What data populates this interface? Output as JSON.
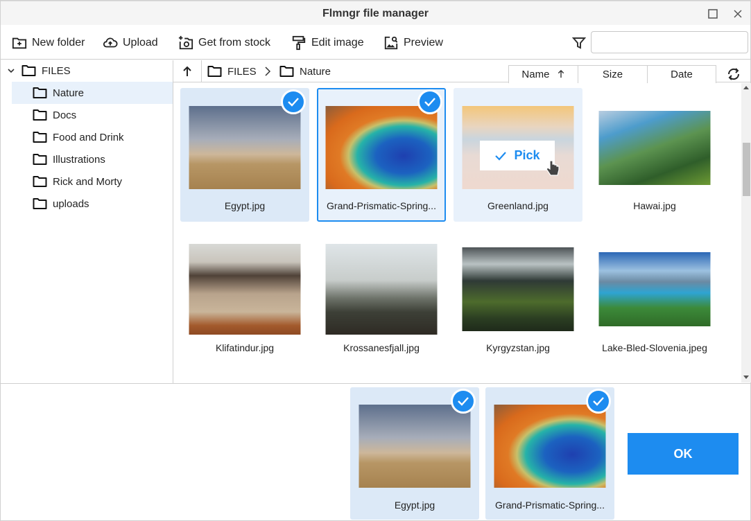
{
  "window": {
    "title": "Flmngr file manager",
    "maximize_icon": "square-icon",
    "close_icon": "close-icon"
  },
  "toolbar": {
    "buttons": [
      {
        "label": "New folder",
        "icon": "folder-plus-icon"
      },
      {
        "label": "Upload",
        "icon": "cloud-upload-icon"
      },
      {
        "label": "Get from stock",
        "icon": "camera-plus-icon"
      },
      {
        "label": "Edit image",
        "icon": "paint-roller-icon"
      },
      {
        "label": "Preview",
        "icon": "image-search-icon"
      }
    ],
    "filter_icon": "filter-icon",
    "search": {
      "value": "",
      "placeholder": ""
    }
  },
  "sidebar": {
    "root": {
      "label": "FILES",
      "expanded": true
    },
    "items": [
      {
        "label": "Nature",
        "active": true
      },
      {
        "label": "Docs",
        "active": false
      },
      {
        "label": "Food and Drink",
        "active": false
      },
      {
        "label": "Illustrations",
        "active": false
      },
      {
        "label": "Rick and Morty",
        "active": false
      },
      {
        "label": "uploads",
        "active": false
      }
    ]
  },
  "breadcrumb": {
    "items": [
      "FILES",
      "Nature"
    ]
  },
  "sort": {
    "tabs": [
      {
        "label": "Name",
        "active": true,
        "direction": "ascending"
      },
      {
        "label": "Size",
        "active": false
      },
      {
        "label": "Date",
        "active": false
      }
    ],
    "refresh_icon": "refresh-icon"
  },
  "files": [
    {
      "name": "Egypt.jpg",
      "selected": true,
      "state": "selected"
    },
    {
      "name": "Grand-Prismatic-Spring...",
      "selected": true,
      "state": "focused"
    },
    {
      "name": "Greenland.jpg",
      "selected": false,
      "state": "hovered",
      "pick_label": "Pick"
    },
    {
      "name": "Hawai.jpg",
      "selected": false,
      "state": "normal"
    },
    {
      "name": "Klifatindur.jpg",
      "selected": false,
      "state": "normal"
    },
    {
      "name": "Krossanesfjall.jpg",
      "selected": false,
      "state": "normal"
    },
    {
      "name": "Kyrgyzstan.jpg",
      "selected": false,
      "state": "normal"
    },
    {
      "name": "Lake-Bled-Slovenia.jpeg",
      "selected": false,
      "state": "normal"
    }
  ],
  "picked": [
    {
      "name": "Egypt.jpg"
    },
    {
      "name": "Grand-Prismatic-Spring..."
    }
  ],
  "ok_label": "OK",
  "colors": {
    "accent": "#1d8cf0",
    "selected_bg": "#dce9f7",
    "hover_bg": "#e8f1fb"
  }
}
